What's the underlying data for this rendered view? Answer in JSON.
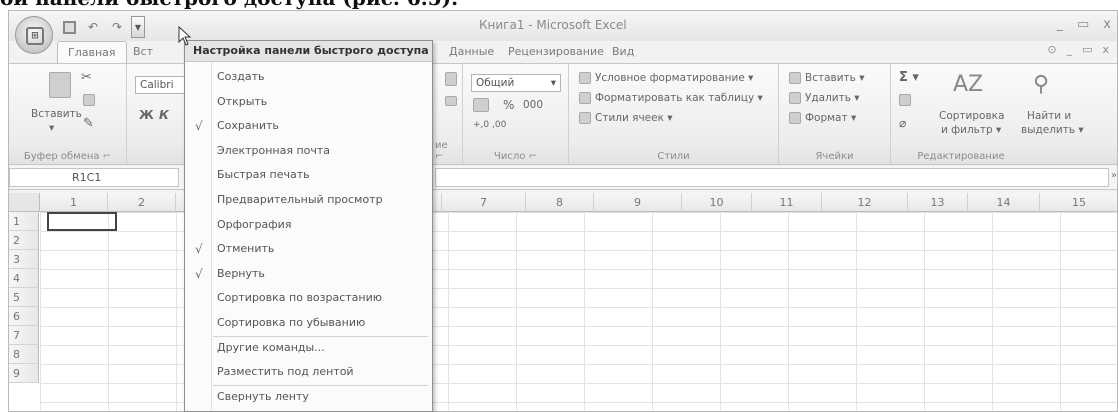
{
  "caption": "ой панели быстрого доступа (рис. 6.5).",
  "window": {
    "title": "Книга1 - Microsoft Excel",
    "controls": [
      "_",
      "▭",
      "x"
    ]
  },
  "tabs": {
    "home": "Главная",
    "insert_partial": "Вст",
    "data": "Данные",
    "review": "Рецензирование",
    "view": "Вид",
    "help": [
      "⊙",
      "_",
      "▭",
      "x"
    ]
  },
  "ribbon": {
    "clipboard": {
      "paste": "Вставить",
      "label": "Буфер обмена"
    },
    "font": {
      "name": "Calibri",
      "bold": "Ж",
      "italic": "К"
    },
    "number": {
      "format": "Общий",
      "percent": "%",
      "thousands": "000",
      "dec_inc": "+,0  ,00",
      "dec_dec": ",00  +,0",
      "label": "Число"
    },
    "styles": {
      "conditional": "Условное форматирование",
      "as_table": "Форматировать как таблицу",
      "cell_styles": "Стили ячеек",
      "label": "Стили"
    },
    "cells": {
      "insert": "Вставить",
      "delete": "Удалить",
      "format": "Формат",
      "label": "Ячейки"
    },
    "editing": {
      "sum": "Σ",
      "sort_line1": "Сортировка",
      "sort_line2": "и фильтр",
      "find_line1": "Найти и",
      "find_line2": "выделить",
      "label": "Редактирование"
    },
    "partial_labels": {
      "alignment_tail": "ие"
    }
  },
  "formula_bar": {
    "name_box": "R1C1"
  },
  "grid": {
    "columns": [
      "1",
      "2",
      "7",
      "8",
      "9",
      "10",
      "11",
      "12",
      "13",
      "14",
      "15"
    ],
    "rows": [
      "1",
      "2",
      "3",
      "4",
      "5",
      "6",
      "7",
      "8",
      "9"
    ]
  },
  "menu": {
    "header": "Настройка панели быстрого доступа",
    "items": [
      {
        "label": "Создать",
        "checked": false
      },
      {
        "label": "Открыть",
        "checked": false
      },
      {
        "label": "Сохранить",
        "checked": true
      },
      {
        "label": "Электронная почта",
        "checked": false
      },
      {
        "label": "Быстрая печать",
        "checked": false
      },
      {
        "label": "Предварительный просмотр",
        "checked": false
      },
      {
        "label": "Орфография",
        "checked": false
      },
      {
        "label": "Отменить",
        "checked": true
      },
      {
        "label": "Вернуть",
        "checked": true
      },
      {
        "label": "Сортировка по возрастанию",
        "checked": false
      },
      {
        "label": "Сортировка по убыванию",
        "checked": false
      },
      {
        "label": "Другие команды...",
        "checked": false
      },
      {
        "label": "Разместить под лентой",
        "checked": false
      },
      {
        "label": "Свернуть ленту",
        "checked": false
      }
    ],
    "check_glyph": "√"
  }
}
